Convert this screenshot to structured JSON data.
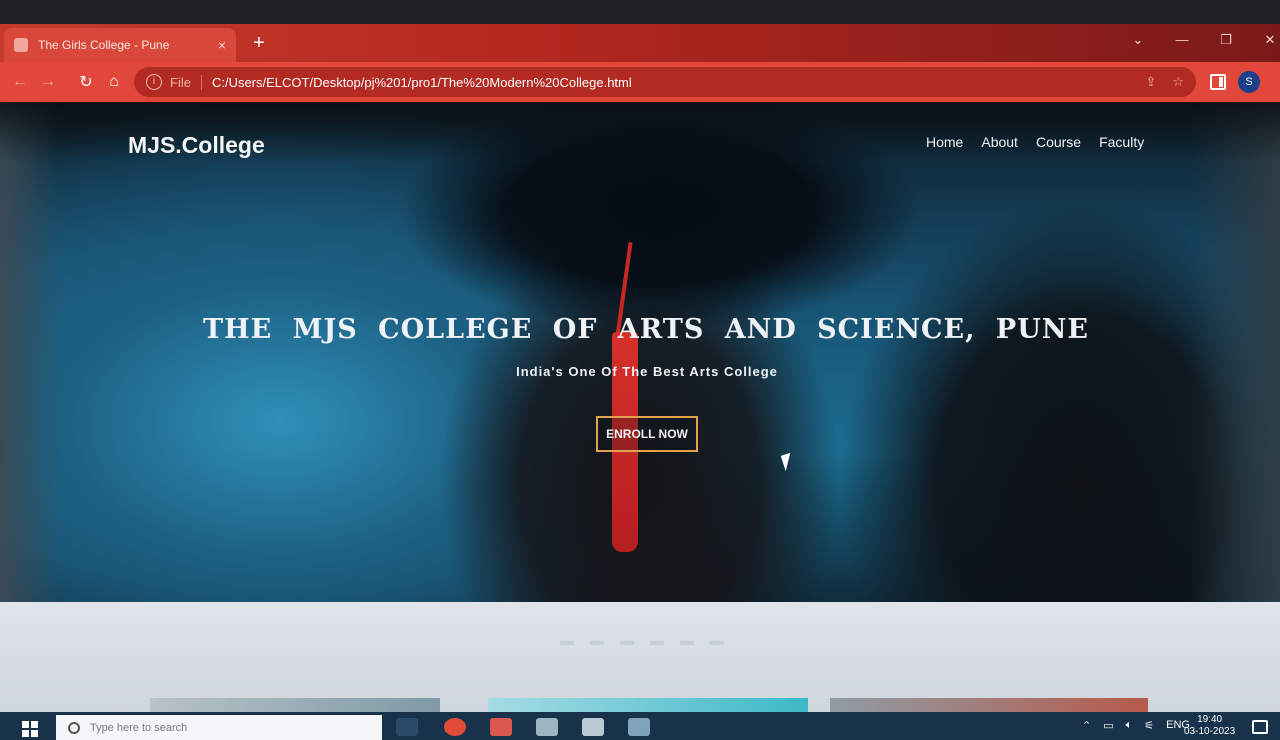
{
  "browser": {
    "tab_title": "The Girls College - Pune",
    "tab_close_glyph": "×",
    "new_tab_glyph": "+",
    "window_controls": [
      "⌄",
      "—",
      "❐",
      "✕"
    ],
    "back_glyph": "←",
    "forward_glyph": "→",
    "reload_glyph": "↻",
    "home_glyph": "⌂",
    "scheme_label": "File",
    "url": "C:/Users/ELCOT/Desktop/pj%201/pro1/The%20Modern%20College.html",
    "share_glyph": "⇪",
    "bookmark_glyph": "☆",
    "profile_initial": "S",
    "accent_color": "#e2473b"
  },
  "site": {
    "brand": "MJS.College",
    "menu": [
      "Home",
      "About",
      "Course",
      "Faculty"
    ],
    "hero_title": "THE MJS COLLEGE OF ARTS AND SCIENCE, PUNE",
    "hero_subtitle": "India's One Of The Best Arts College",
    "cta_label": "ENROLL NOW",
    "cta_border_color": "#e0a24b"
  },
  "taskbar": {
    "search_placeholder": "Type here to search",
    "language": "ENG",
    "time": "19:40",
    "date": "03-10-2023"
  }
}
